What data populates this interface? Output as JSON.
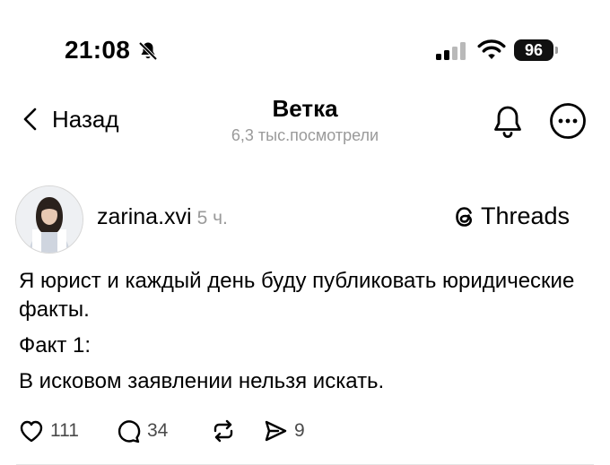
{
  "status_bar": {
    "time": "21:08",
    "battery": "96",
    "icons": [
      "bell-slash-icon",
      "cellular-signal-icon",
      "wifi-icon",
      "battery-icon"
    ]
  },
  "nav": {
    "back_label": "Назад",
    "title": "Ветка",
    "subtitle": "6,3 тыс.посмотрели",
    "icons": [
      "chevron-left-icon",
      "bell-icon",
      "more-horizontal-icon"
    ]
  },
  "post": {
    "username": "zarina.xvi",
    "time": "5 ч.",
    "brand": "Threads",
    "paragraphs": [
      "Я юрист и каждый день буду публиковать юридические факты.",
      "Факт 1:",
      "В исковом заявлении нельзя искать."
    ],
    "actions": {
      "likes": "111",
      "replies": "34",
      "shares": "9"
    }
  }
}
